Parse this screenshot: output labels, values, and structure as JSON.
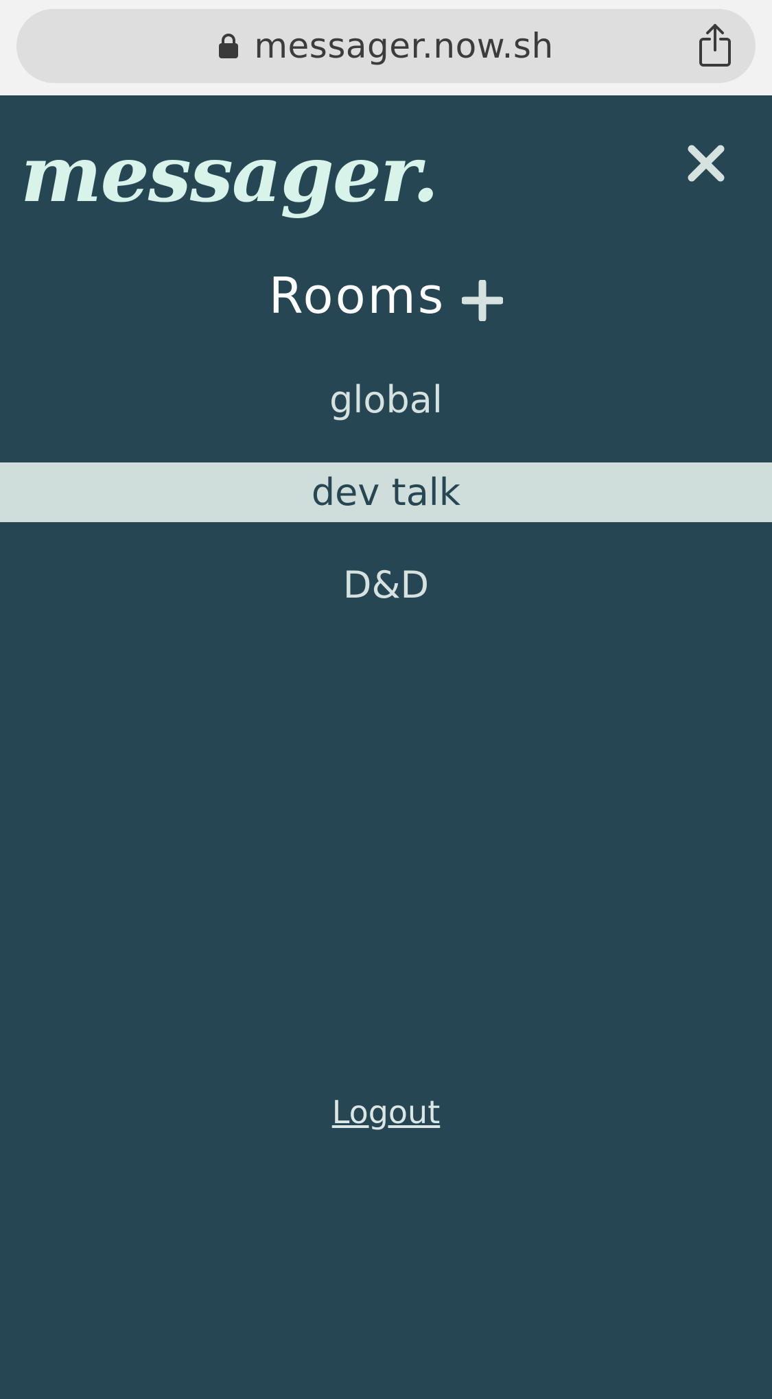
{
  "browser": {
    "url": "messager.now.sh",
    "lock_icon": "lock-icon",
    "share_icon": "share-icon"
  },
  "app": {
    "logo_text": "messager.",
    "close_icon": "close-icon",
    "colors": {
      "background": "#264653",
      "logo": "#d8f3ea",
      "active_room_bg": "#d0dedb",
      "text": "#d6e2df"
    }
  },
  "rooms": {
    "title": "Rooms",
    "add_icon": "plus-icon",
    "items": [
      {
        "label": "global",
        "active": false
      },
      {
        "label": "dev talk",
        "active": true
      },
      {
        "label": "D&D",
        "active": false
      }
    ]
  },
  "footer": {
    "logout_label": "Logout"
  }
}
